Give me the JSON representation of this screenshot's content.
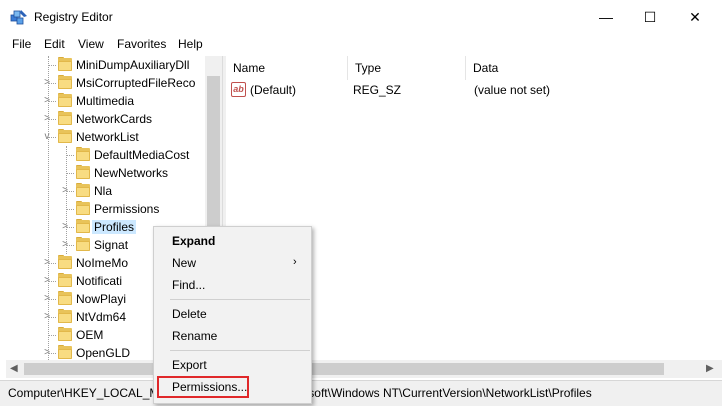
{
  "window": {
    "title": "Registry Editor",
    "minimize_glyph": "—",
    "maximize_glyph": "☐",
    "close_glyph": "✕"
  },
  "menu": [
    "File",
    "Edit",
    "View",
    "Favorites",
    "Help"
  ],
  "tree": {
    "items": [
      {
        "label": "MiniDumpAuxiliaryDll",
        "level": 2,
        "expander": ""
      },
      {
        "label": "MsiCorruptedFileReco",
        "level": 2,
        "expander": ">"
      },
      {
        "label": "Multimedia",
        "level": 2,
        "expander": ">"
      },
      {
        "label": "NetworkCards",
        "level": 2,
        "expander": ">"
      },
      {
        "label": "NetworkList",
        "level": 2,
        "expander": "v"
      },
      {
        "label": "DefaultMediaCost",
        "level": 3,
        "expander": ""
      },
      {
        "label": "NewNetworks",
        "level": 3,
        "expander": ""
      },
      {
        "label": "Nla",
        "level": 3,
        "expander": ">"
      },
      {
        "label": "Permissions",
        "level": 3,
        "expander": ""
      },
      {
        "label": "Profiles",
        "level": 3,
        "expander": ">",
        "selected": true
      },
      {
        "label": "Signat",
        "level": 3,
        "expander": ">"
      },
      {
        "label": "NoImeMo",
        "level": 2,
        "expander": ">"
      },
      {
        "label": "Notificati",
        "level": 2,
        "expander": ">"
      },
      {
        "label": "NowPlayi",
        "level": 2,
        "expander": ">"
      },
      {
        "label": "NtVdm64",
        "level": 2,
        "expander": ">"
      },
      {
        "label": "OEM",
        "level": 2,
        "expander": ""
      },
      {
        "label": "OpenGLD",
        "level": 2,
        "expander": ">"
      }
    ]
  },
  "list": {
    "columns": [
      "Name",
      "Type",
      "Data"
    ],
    "rows": [
      {
        "icon": "string-value-icon",
        "icon_text": "ab",
        "name": "(Default)",
        "type": "REG_SZ",
        "data": "(value not set)"
      }
    ]
  },
  "status_bar": {
    "path": "Computer\\HKEY_LOCAL_MACHINE\\SOFTWARE\\Microsoft\\Windows NT\\CurrentVersion\\NetworkList\\Profiles"
  },
  "context_menu": {
    "items": [
      {
        "label": "Expand",
        "bold": true
      },
      {
        "label": "New",
        "submenu": true
      },
      {
        "label": "Find..."
      },
      {
        "separator": true
      },
      {
        "label": "Delete"
      },
      {
        "label": "Rename"
      },
      {
        "separator": true
      },
      {
        "label": "Export"
      },
      {
        "label": "Permissions...",
        "highlighted": true
      }
    ],
    "highlight_color": "#e0282a"
  },
  "colors": {
    "selection": "#cce8ff",
    "folder": "#f8dc82"
  }
}
